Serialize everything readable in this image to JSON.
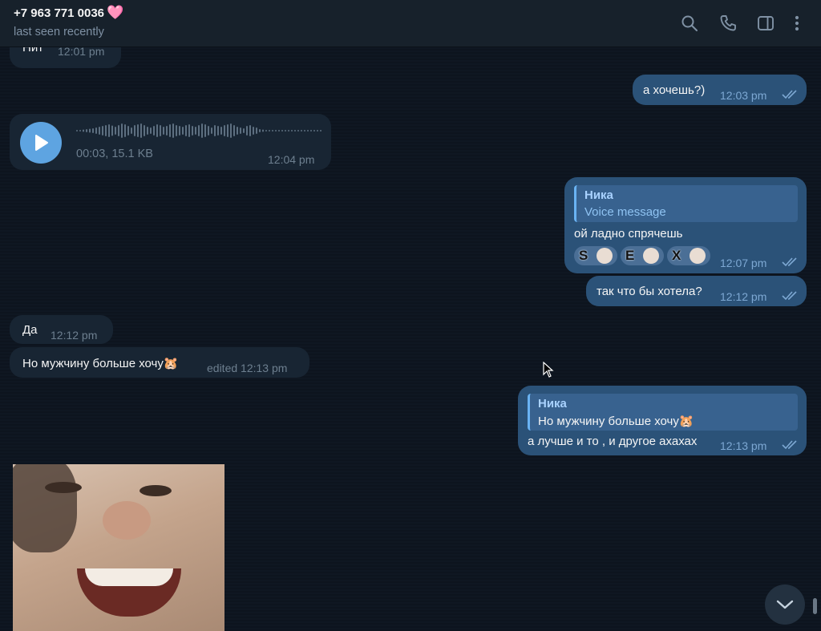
{
  "header": {
    "contact_name": "+7 963 771 0036",
    "contact_emoji": "🩷",
    "status": "last seen recently",
    "icons": [
      "search-icon",
      "phone-icon",
      "sidebar-toggle-icon",
      "more-vertical-icon"
    ]
  },
  "messages": [
    {
      "id": "m1",
      "direction": "in",
      "text": "Нит",
      "time": "12:01 pm"
    },
    {
      "id": "m2",
      "direction": "out",
      "text": "а хочешь?)",
      "time": "12:03 pm",
      "read": true
    },
    {
      "id": "m3",
      "direction": "in",
      "type": "voice",
      "meta": "00:03, 15.1 KB",
      "time": "12:04 pm"
    },
    {
      "id": "m4",
      "direction": "out",
      "reply_name": "Ника",
      "reply_text": "Voice message",
      "text": "ой ладно спрячешь",
      "time": "12:07 pm",
      "read": true,
      "reactions": [
        "S",
        "E",
        "X"
      ]
    },
    {
      "id": "m5",
      "direction": "out",
      "text": "так что бы хотела?",
      "time": "12:12 pm",
      "read": true
    },
    {
      "id": "m6",
      "direction": "in",
      "text": "Да",
      "time": "12:12 pm"
    },
    {
      "id": "m7",
      "direction": "in",
      "text": "Но мужчину больше хочу",
      "emoji": "🐹",
      "time": "edited 12:13 pm"
    },
    {
      "id": "m8",
      "direction": "out",
      "reply_name": "Ника",
      "reply_text": "Но мужчину больше хочу",
      "reply_emoji": "🐹",
      "text": "а лучше и то , и другое ахахах",
      "time": "12:13 pm",
      "read": true
    },
    {
      "id": "m9",
      "direction": "in",
      "type": "photo"
    }
  ],
  "colors": {
    "background": "#0e1621",
    "header": "#17212b",
    "incoming_bubble": "#182533",
    "outgoing_bubble": "#2b5278",
    "accent": "#5ea4e1"
  }
}
